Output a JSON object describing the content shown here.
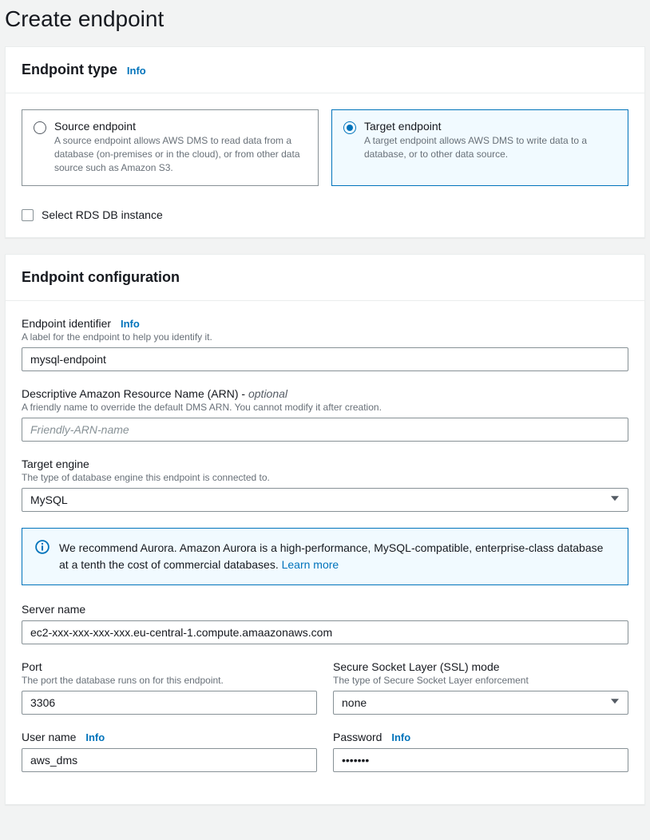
{
  "page_title": "Create endpoint",
  "info_label": "Info",
  "endpoint_type": {
    "title": "Endpoint type",
    "source": {
      "title": "Source endpoint",
      "desc": "A source endpoint allows AWS DMS to read data from a database (on-premises or in the cloud), or from other data source such as Amazon S3.",
      "selected": false
    },
    "target": {
      "title": "Target endpoint",
      "desc": "A target endpoint allows AWS DMS to write data to a database, or to other data source.",
      "selected": true
    },
    "select_rds_label": "Select RDS DB instance"
  },
  "config": {
    "title": "Endpoint configuration",
    "identifier": {
      "label": "Endpoint identifier",
      "hint": "A label for the endpoint to help you identify it.",
      "value": "mysql-endpoint"
    },
    "arn": {
      "label": "Descriptive Amazon Resource Name (ARN) - ",
      "optional": "optional",
      "hint": "A friendly name to override the default DMS ARN. You cannot modify it after creation.",
      "placeholder": "Friendly-ARN-name",
      "value": ""
    },
    "engine": {
      "label": "Target engine",
      "hint": "The type of database engine this endpoint is connected to.",
      "value": "MySQL"
    },
    "aurora_notice": {
      "text": "We recommend Aurora. Amazon Aurora is a high-performance, MySQL-compatible, enterprise-class database at a tenth the cost of commercial databases. ",
      "learn_more": "Learn more"
    },
    "server": {
      "label": "Server name",
      "value": "ec2-xxx-xxx-xxx-xxx.eu-central-1.compute.amaazonaws.com"
    },
    "port": {
      "label": "Port",
      "hint": "The port the database runs on for this endpoint.",
      "value": "3306"
    },
    "ssl": {
      "label": "Secure Socket Layer (SSL) mode",
      "hint": "The type of Secure Socket Layer enforcement",
      "value": "none"
    },
    "username": {
      "label": "User name",
      "value": "aws_dms"
    },
    "password": {
      "label": "Password",
      "value": "•••••••"
    }
  }
}
